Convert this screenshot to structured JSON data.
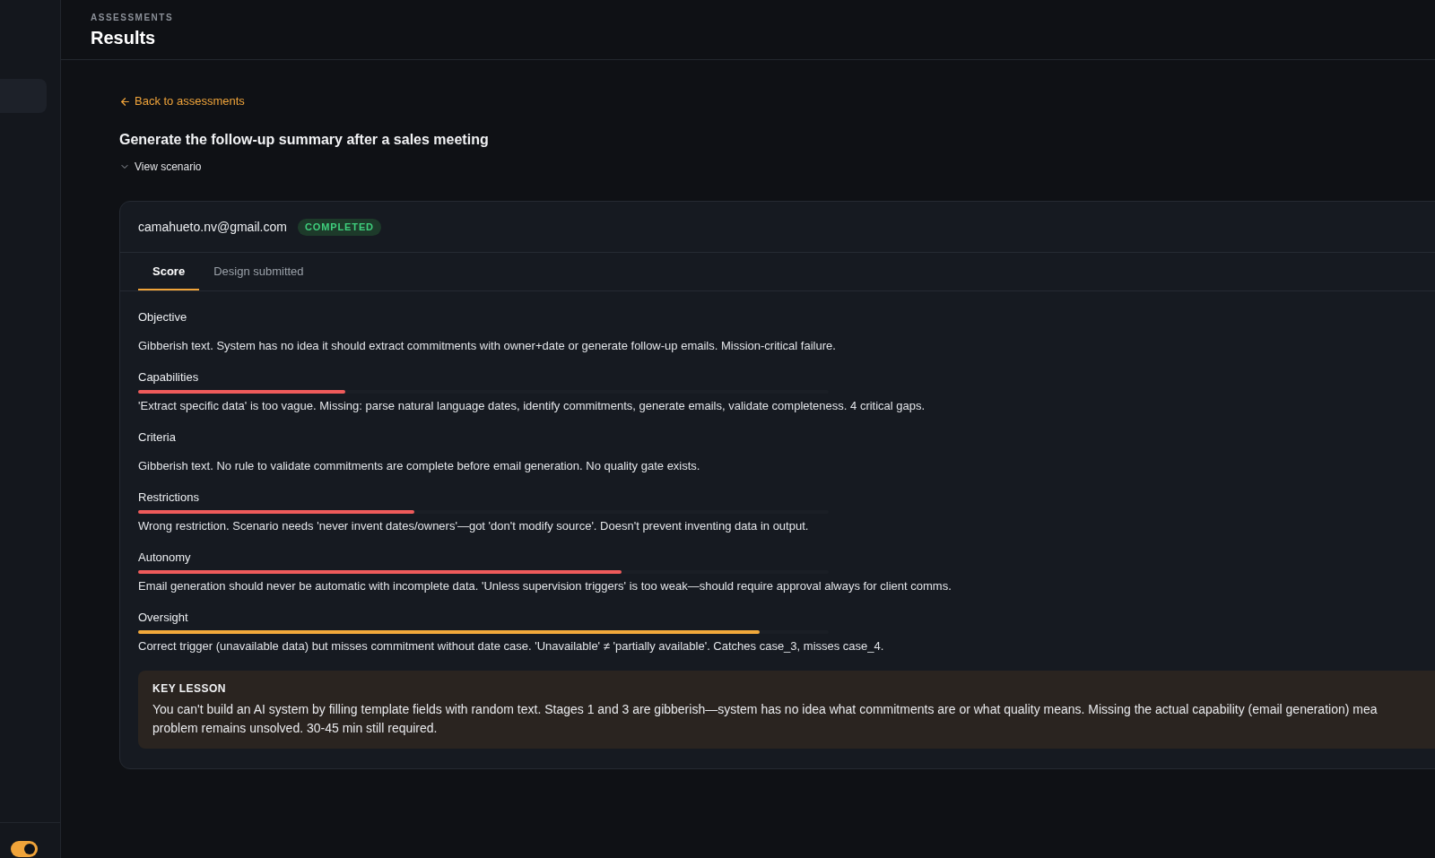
{
  "sidebar": {
    "items": [
      {
        "selected": true
      }
    ],
    "toggle": {
      "on": true
    }
  },
  "header": {
    "eyebrow": "ASSESSMENTS",
    "title": "Results"
  },
  "back_link": {
    "label": "Back to assessments"
  },
  "scenario": {
    "title": "Generate the follow-up summary after a sales meeting",
    "toggle": {
      "label": "View scenario",
      "expanded": false
    }
  },
  "submission": {
    "email": "camahueto.nv@gmail.com",
    "status": {
      "label": "COMPLETED",
      "kind": "completed"
    },
    "tabs": [
      {
        "label": "Score",
        "selected": true
      },
      {
        "label": "Design submitted",
        "selected": false
      }
    ],
    "criteria": [
      {
        "name": "Objective",
        "feedback": "Gibberish text. System has no idea it should extract commitments with owner+date or generate follow-up emails. Mission-critical failure."
      },
      {
        "name": "Capabilities",
        "level": 0.3,
        "color": "#ef5b5b",
        "feedback": "'Extract specific data' is too vague. Missing: parse natural language dates, identify commitments, generate emails, validate completeness. 4 critical gaps."
      },
      {
        "name": "Criteria",
        "feedback": "Gibberish text. No rule to validate commitments are complete before email generation. No quality gate exists."
      },
      {
        "name": "Restrictions",
        "level": 0.4,
        "color": "#ef5b5b",
        "feedback": "Wrong restriction. Scenario needs 'never invent dates/owners'—got 'don't modify source'. Doesn't prevent inventing data in output."
      },
      {
        "name": "Autonomy",
        "level": 0.7,
        "color": "#ef5b5b",
        "feedback": "Email generation should never be automatic with incomplete data. 'Unless supervision triggers' is too weak—should require approval always for client comms."
      },
      {
        "name": "Oversight",
        "level": 0.9,
        "color": "#f2a93b",
        "feedback": "Correct trigger (unavailable data) but misses commitment without date case. 'Unavailable' ≠ 'partially available'. Catches case_3, misses case_4."
      }
    ],
    "key_lesson": {
      "heading": "KEY LESSON",
      "lines": [
        "You can't build an AI system by filling template fields with random text. Stages 1 and 3 are gibberish—system has no idea what commitments are or what quality means. Missing the actual capability (email generation) mea",
        "problem remains unsolved. 30-45 min still required."
      ]
    }
  }
}
